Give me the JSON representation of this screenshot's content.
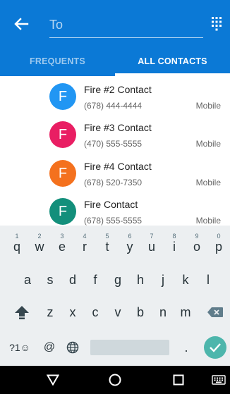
{
  "header": {
    "to_placeholder": "To",
    "back_icon": "back-arrow-icon",
    "dialpad_icon": "dialpad-icon",
    "background_color": "#0b79d6"
  },
  "tabs": [
    {
      "label": "FREQUENTS",
      "active": false
    },
    {
      "label": "ALL CONTACTS",
      "active": true
    }
  ],
  "contacts": [
    {
      "initial": "F",
      "name": "Fire #2 Contact",
      "phone": "(678) 444-4444",
      "type": "Mobile",
      "color": "#2196f3"
    },
    {
      "initial": "F",
      "name": "Fire #3 Contact",
      "phone": "(470) 555-5555",
      "type": "Mobile",
      "color": "#e91e63"
    },
    {
      "initial": "F",
      "name": "Fire #4 Contact",
      "phone": "(678) 520-7350",
      "type": "Mobile",
      "color": "#f4711e"
    },
    {
      "initial": "F",
      "name": "Fire Contact",
      "phone": "(678) 555-5555",
      "type": "Mobile",
      "color": "#138f7b"
    }
  ],
  "keyboard": {
    "row1": [
      {
        "hint": "1",
        "key": "q"
      },
      {
        "hint": "2",
        "key": "w"
      },
      {
        "hint": "3",
        "key": "e"
      },
      {
        "hint": "4",
        "key": "r"
      },
      {
        "hint": "5",
        "key": "t"
      },
      {
        "hint": "6",
        "key": "y"
      },
      {
        "hint": "7",
        "key": "u"
      },
      {
        "hint": "8",
        "key": "i"
      },
      {
        "hint": "9",
        "key": "o"
      },
      {
        "hint": "0",
        "key": "p"
      }
    ],
    "row2": [
      "a",
      "s",
      "d",
      "f",
      "g",
      "h",
      "j",
      "k",
      "l"
    ],
    "row3": [
      "z",
      "x",
      "c",
      "v",
      "b",
      "n",
      "m"
    ],
    "symbols_label": "?1☺",
    "at_label": "@",
    "period_label": ".",
    "shift_icon": "shift-icon",
    "backspace_icon": "backspace-icon",
    "globe_icon": "globe-icon",
    "send_icon": "checkmark-icon",
    "send_color": "#4db6ac"
  },
  "navbar": {
    "back_icon": "nav-back-icon",
    "home_icon": "nav-home-icon",
    "recents_icon": "nav-recents-icon",
    "keyboard_icon": "keyboard-icon"
  }
}
